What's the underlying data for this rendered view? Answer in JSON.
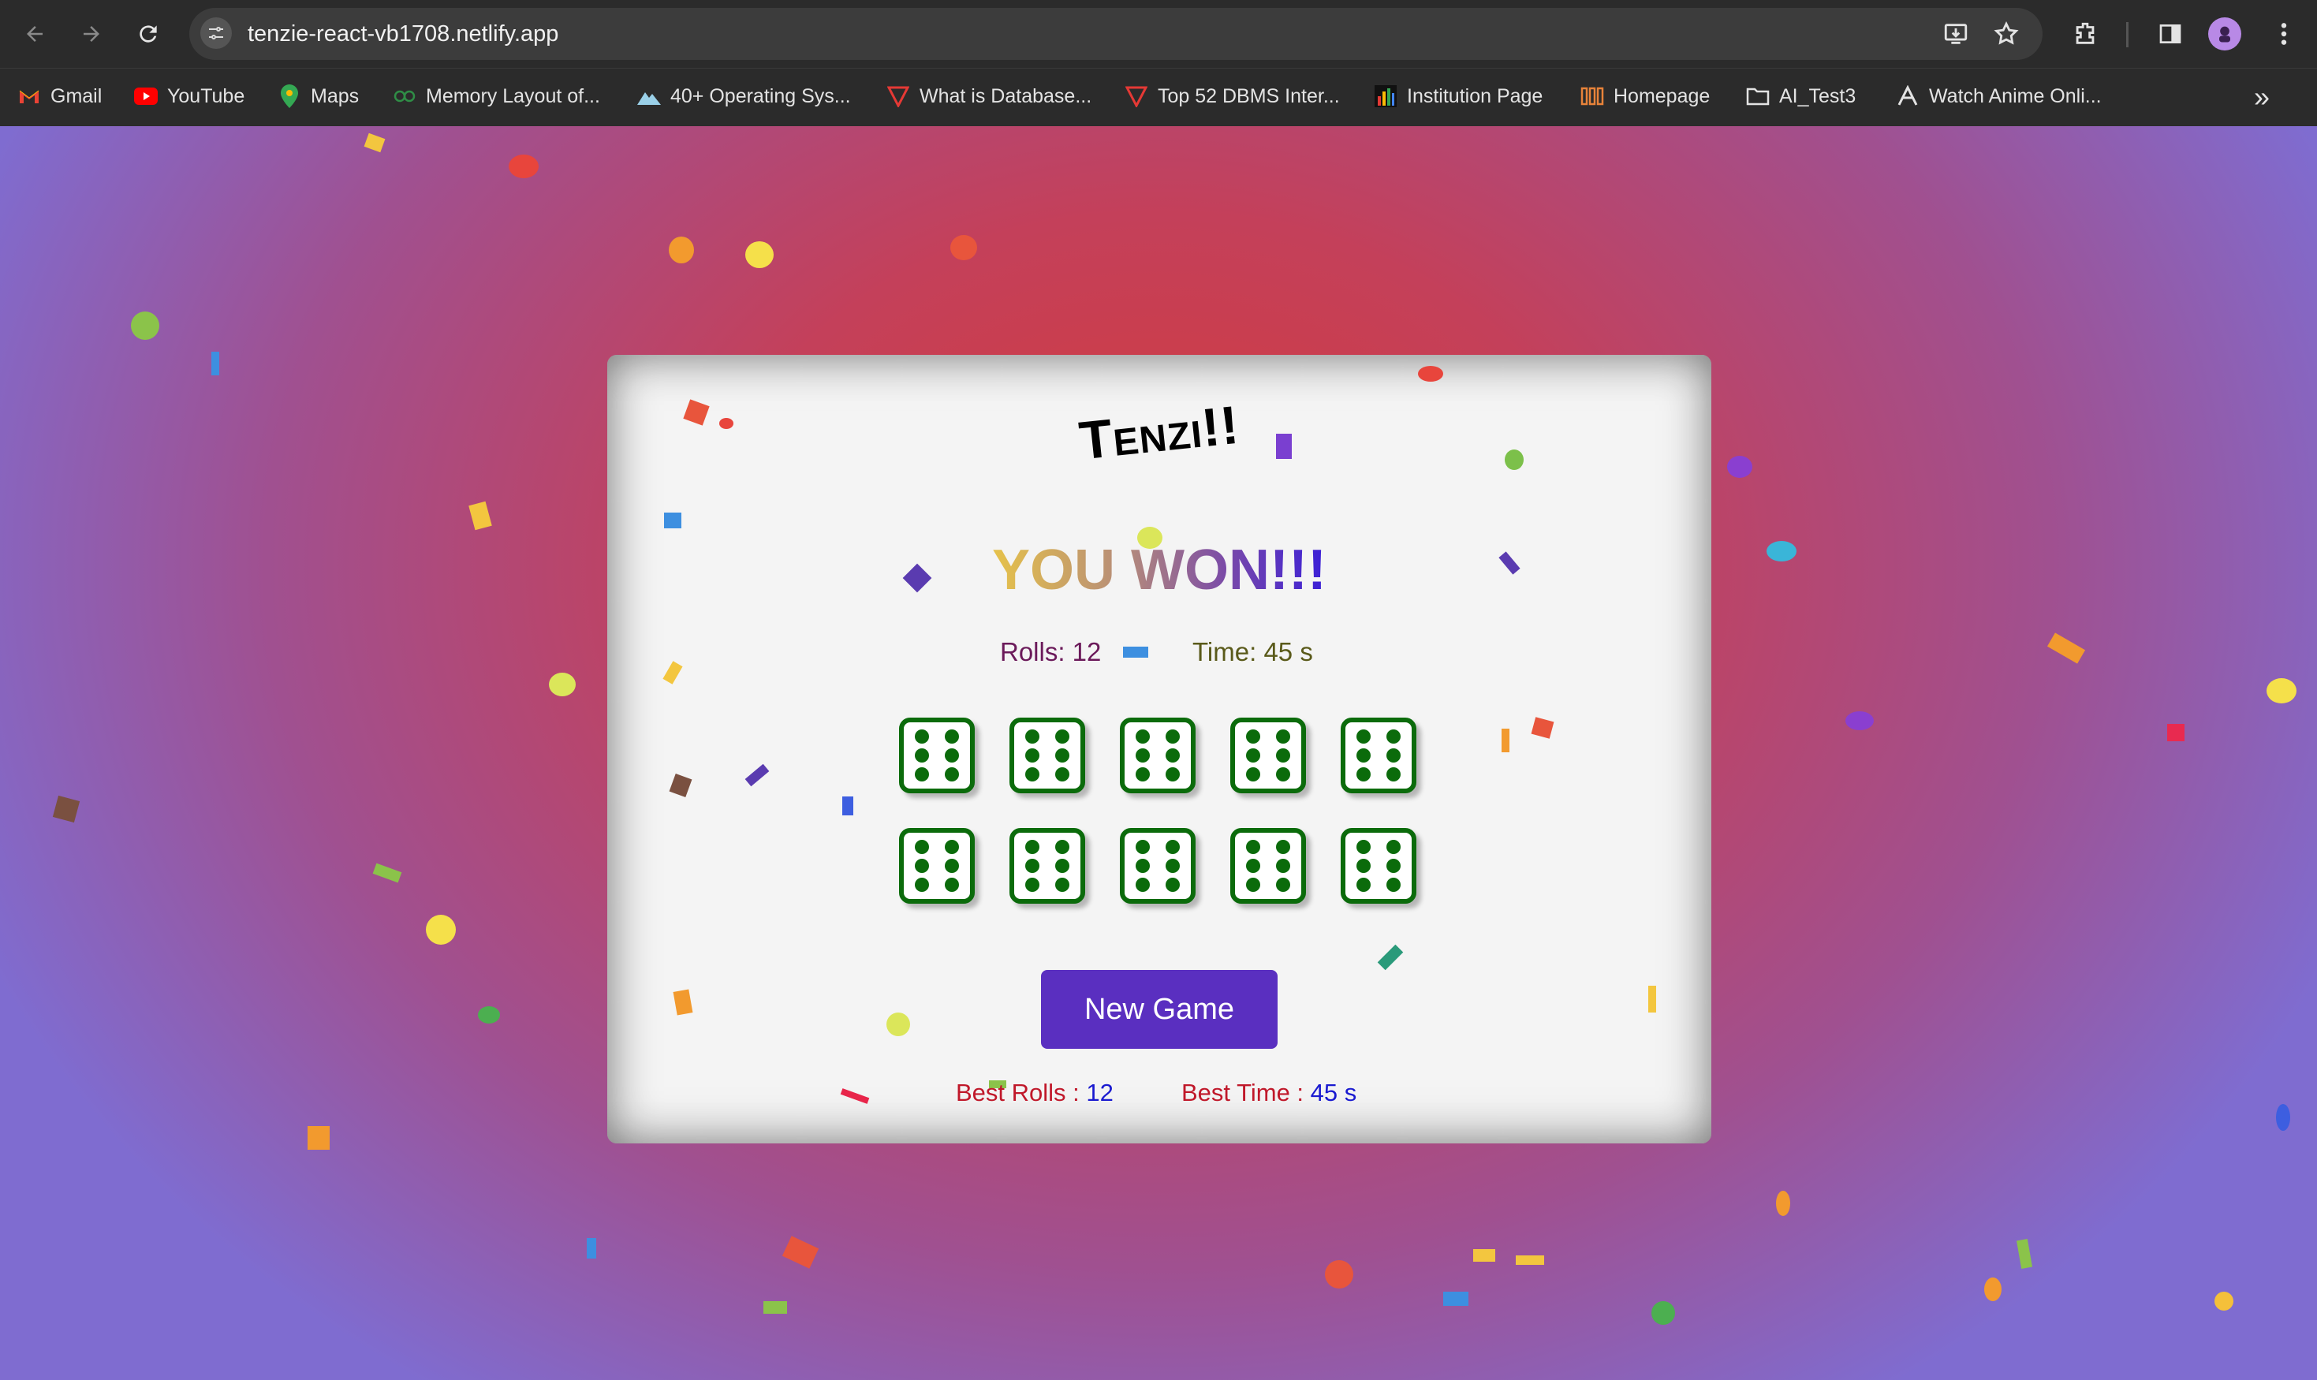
{
  "browser": {
    "url": "tenzie-react-vb1708.netlify.app",
    "bookmarks": [
      {
        "label": "Gmail",
        "icon": "gmail-icon"
      },
      {
        "label": "YouTube",
        "icon": "youtube-icon"
      },
      {
        "label": "Maps",
        "icon": "maps-icon"
      },
      {
        "label": "Memory Layout of...",
        "icon": "geeksforgeeks-icon"
      },
      {
        "label": "40+ Operating Sys...",
        "icon": "mountain-icon"
      },
      {
        "label": "What is Database...",
        "icon": "tutorial-icon"
      },
      {
        "label": "Top 52 DBMS Inter...",
        "icon": "tutorial-icon"
      },
      {
        "label": "Institution Page",
        "icon": "bar-chart-icon"
      },
      {
        "label": "Homepage",
        "icon": "homepage-icon"
      },
      {
        "label": "AI_Test3",
        "icon": "folder-icon"
      },
      {
        "label": "Watch Anime Onli...",
        "icon": "anime-icon"
      }
    ]
  },
  "game": {
    "title": "Tenzi!!",
    "won_message": "YOU WON!!!",
    "rolls_text": "Rolls: 12",
    "time_text": "Time: 45 s",
    "dice": [
      6,
      6,
      6,
      6,
      6,
      6,
      6,
      6,
      6,
      6
    ],
    "new_game_label": "New Game",
    "best_rolls_label": "Best Rolls :",
    "best_rolls_value": "12",
    "best_time_label": "Best Time :",
    "best_time_value": "45 s"
  },
  "colors": {
    "die_border": "#0b6b0b",
    "button": "#5a2fc0",
    "best_label": "#c0182a",
    "best_value": "#1a1ad0",
    "rolls_text": "#6b1a5a",
    "time_text": "#5a5a1a"
  }
}
